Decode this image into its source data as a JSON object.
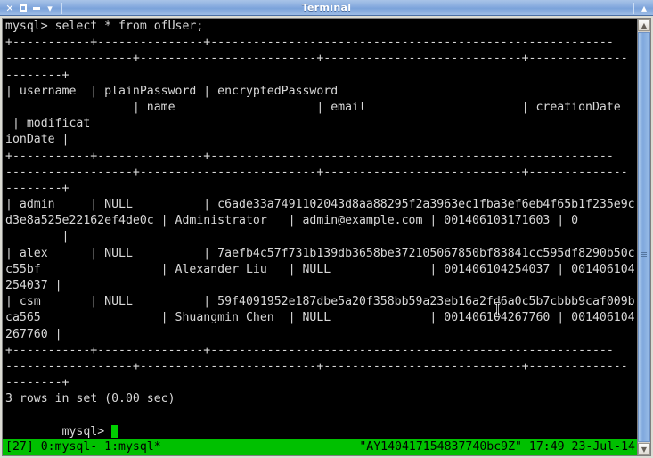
{
  "window": {
    "title": "Terminal",
    "controls": {
      "close_label": "✕",
      "maximize_label": "maximize",
      "minimize_label": "minimize",
      "menu_label": "▾",
      "expand_label": "▴"
    }
  },
  "scrollbar": {
    "up_label": "▲",
    "down_label": "▼"
  },
  "terminal": {
    "lines": [
      "mysql> select * from ofUser;",
      "+-----------+---------------+---------------------------------------------------------",
      "------------------+-------------------------+----------------------------+--------------",
      "--------+",
      "| username  | plainPassword | encryptedPassword                                        ",
      "                  | name                    | email                      | creationDate  ",
      " | modificat",
      "ionDate |",
      "+-----------+---------------+---------------------------------------------------------",
      "------------------+-------------------------+----------------------------+--------------",
      "--------+",
      "| admin     | NULL          | c6ade33a7491102043d8aa88295f2a3963ec1fba3ef6eb4f65b1f235e9c",
      "d3e8a525e22162ef4de0c | Administrator   | admin@example.com | 001406103171603 | 0",
      "        |",
      "| alex      | NULL          | 7aefb4c57f731b139db3658be372105067850bf83841cc595df8290b50c",
      "c55bf                 | Alexander Liu   | NULL              | 001406104254037 | 001406104",
      "254037 |",
      "| csm       | NULL          | 59f4091952e187dbe5a20f358bb59a23eb16a2fd6a0c5b7cbbb9caf009b",
      "ca565                 | Shuangmin Chen  | NULL              | 001406104267760 | 001406104",
      "267760 |",
      "+-----------+---------------+---------------------------------------------------------",
      "------------------+-------------------------+----------------------------+--------------",
      "--------+",
      "3 rows in set (0.00 sec)",
      "",
      "mysql> "
    ],
    "prompt": "mysql> "
  },
  "status_bar": {
    "left": "[27] 0:mysql- 1:mysql*",
    "right": "\"AY140417154837740bc9Z\" 17:49 23-Jul-14"
  },
  "colors": {
    "terminal_bg": "#000000",
    "terminal_fg": "#d8d8d8",
    "status_bg": "#00c000",
    "status_fg": "#000000",
    "cursor": "#00d000",
    "titlebar": "#86aade"
  }
}
